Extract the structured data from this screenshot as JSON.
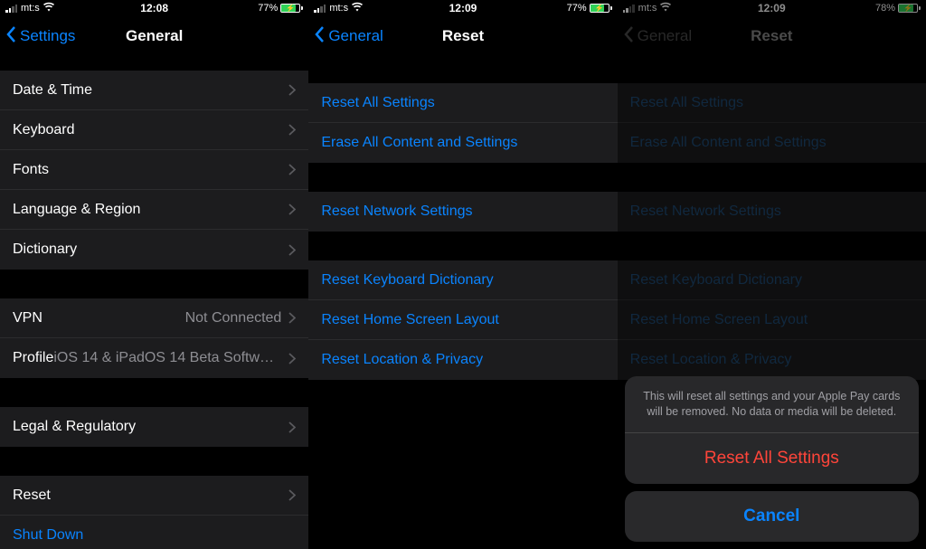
{
  "screens": [
    {
      "status": {
        "carrier": "mt:s",
        "time": "12:08",
        "battery_pct": "77%"
      },
      "nav": {
        "back": "Settings",
        "title": "General"
      },
      "groups": [
        [
          {
            "label": "Date & Time"
          },
          {
            "label": "Keyboard"
          },
          {
            "label": "Fonts"
          },
          {
            "label": "Language & Region"
          },
          {
            "label": "Dictionary"
          }
        ],
        [
          {
            "label": "VPN",
            "value": "Not Connected"
          },
          {
            "label": "Profile",
            "value": "iOS 14 & iPadOS 14 Beta Softwar..."
          }
        ],
        [
          {
            "label": "Legal & Regulatory"
          }
        ],
        [
          {
            "label": "Reset"
          },
          {
            "label": "Shut Down",
            "link": true,
            "no_chevron": true
          }
        ]
      ]
    },
    {
      "status": {
        "carrier": "mt:s",
        "time": "12:09",
        "battery_pct": "77%"
      },
      "nav": {
        "back": "General",
        "title": "Reset"
      },
      "groups": [
        [
          {
            "label": "Reset All Settings",
            "link": true
          },
          {
            "label": "Erase All Content and Settings",
            "link": true
          }
        ],
        [
          {
            "label": "Reset Network Settings",
            "link": true
          }
        ],
        [
          {
            "label": "Reset Keyboard Dictionary",
            "link": true
          },
          {
            "label": "Reset Home Screen Layout",
            "link": true
          },
          {
            "label": "Reset Location & Privacy",
            "link": true
          }
        ]
      ]
    },
    {
      "status": {
        "carrier": "mt:s",
        "time": "12:09",
        "battery_pct": "78%"
      },
      "nav": {
        "back": "General",
        "title": "Reset"
      },
      "groups": [
        [
          {
            "label": "Reset All Settings",
            "link": true
          },
          {
            "label": "Erase All Content and Settings",
            "link": true
          }
        ],
        [
          {
            "label": "Reset Network Settings",
            "link": true
          }
        ],
        [
          {
            "label": "Reset Keyboard Dictionary",
            "link": true
          },
          {
            "label": "Reset Home Screen Layout",
            "link": true
          },
          {
            "label": "Reset Location & Privacy",
            "link": true
          }
        ]
      ],
      "sheet": {
        "message": "This will reset all settings and your Apple Pay cards will be removed. No data or media will be deleted.",
        "destructive": "Reset All Settings",
        "cancel": "Cancel"
      }
    }
  ]
}
